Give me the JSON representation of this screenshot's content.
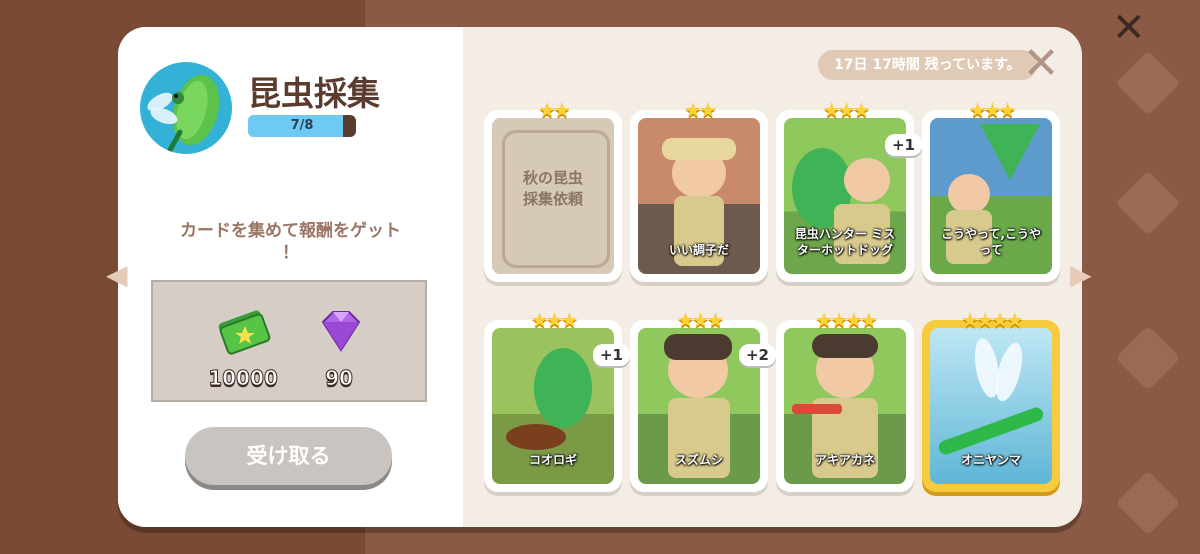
{
  "modal": {
    "title": "昆虫採集",
    "progress": {
      "text": "7/8",
      "value": 0.875
    },
    "prompt": "カードを集めて報酬をゲット\n！",
    "rewards": [
      {
        "icon": "cash-icon",
        "amount": "10000"
      },
      {
        "icon": "gem-icon",
        "amount": "90"
      }
    ],
    "claim_label": "受け取る",
    "timer": "17日 17時間 残っています。",
    "close_symbol": "✕"
  },
  "cards": [
    {
      "label": "秋の昆虫\n採集依頼",
      "stars": "★★",
      "badge": "",
      "locked": true
    },
    {
      "label": "いい調子だ",
      "stars": "★★",
      "badge": ""
    },
    {
      "label": "昆虫ハンター ミス\nターホットドッグ",
      "stars": "★★★",
      "badge": "+1"
    },
    {
      "label": "こうやって,こうや\nって",
      "stars": "★★★",
      "badge": ""
    },
    {
      "label": "コオロギ",
      "stars": "★★★",
      "badge": "+1"
    },
    {
      "label": "スズムシ",
      "stars": "★★★",
      "badge": "+2"
    },
    {
      "label": "アキアカネ",
      "stars": "★★★★",
      "badge": ""
    },
    {
      "label": "オニヤンマ",
      "stars": "★★★★",
      "badge": "",
      "highlight": true
    }
  ],
  "background": {
    "close_symbol": "✕"
  }
}
